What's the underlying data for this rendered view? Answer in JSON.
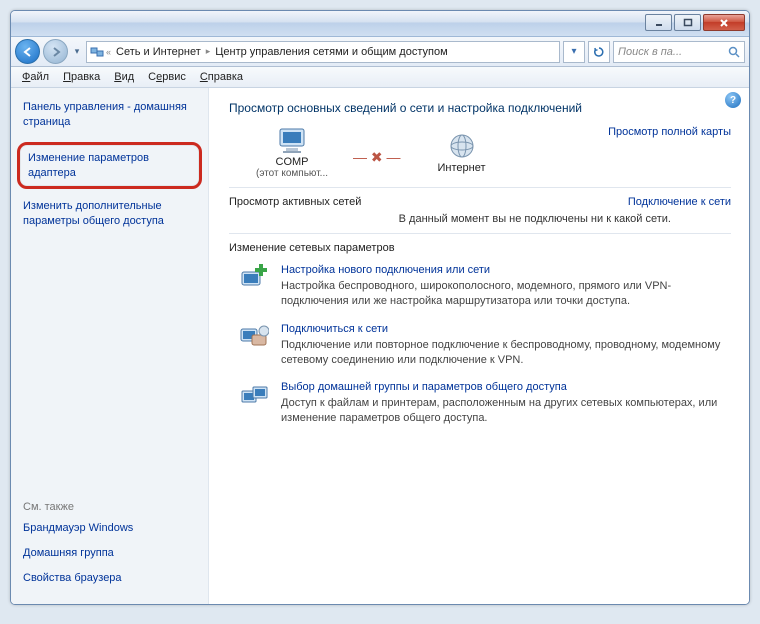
{
  "breadcrumbs": {
    "seg1": "Сеть и Интернет",
    "seg2": "Центр управления сетями и общим доступом"
  },
  "search": {
    "placeholder": "Поиск в па..."
  },
  "menu": {
    "file": "Файл",
    "edit": "Правка",
    "view": "Вид",
    "tools": "Сервис",
    "help": "Справка"
  },
  "sidebar": {
    "home": "Панель управления - домашняя страница",
    "adapter": "Изменение параметров адаптера",
    "sharing": "Изменить дополнительные параметры общего доступа",
    "seealso": "См. также",
    "firewall": "Брандмауэр Windows",
    "homegroup": "Домашняя группа",
    "browser": "Свойства браузера"
  },
  "main": {
    "title": "Просмотр основных сведений о сети и настройка подключений",
    "fullmap": "Просмотр полной карты",
    "node1": "COMP",
    "node1sub": "(этот компьют...",
    "node2": "Интернет",
    "active_title": "Просмотр активных сетей",
    "active_link": "Подключение к сети",
    "active_body": "В данный момент вы не подключены ни к какой сети.",
    "change_title": "Изменение сетевых параметров",
    "opt1_title": "Настройка нового подключения или сети",
    "opt1_desc": "Настройка беспроводного, широкополосного, модемного, прямого или VPN-подключения или же настройка маршрутизатора или точки доступа.",
    "opt2_title": "Подключиться к сети",
    "opt2_desc": "Подключение или повторное подключение к беспроводному, проводному, модемному сетевому соединению или подключение к VPN.",
    "opt3_title": "Выбор домашней группы и параметров общего доступа",
    "opt3_desc": "Доступ к файлам и принтерам, расположенным на других сетевых компьютерах, или изменение параметров общего доступа."
  }
}
